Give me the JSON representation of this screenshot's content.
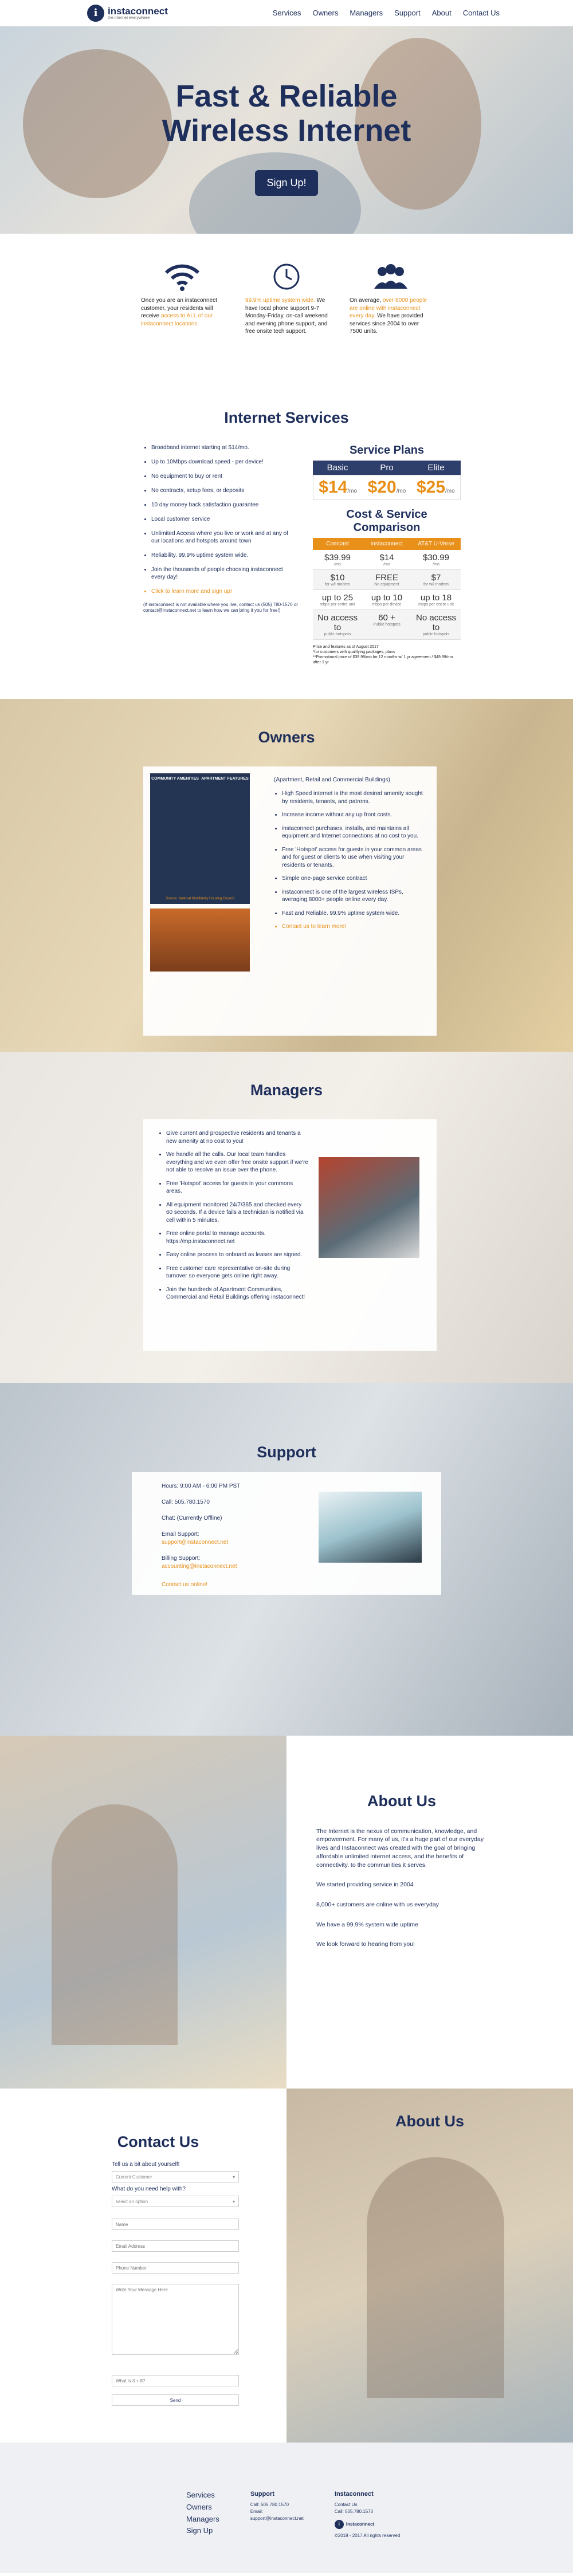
{
  "brand": {
    "name": "instaconnect",
    "tagline": "the internet everywhere",
    "logo_letter": "i"
  },
  "nav": [
    "Services",
    "Owners",
    "Managers",
    "Support",
    "About",
    "Contact Us"
  ],
  "hero": {
    "title_line1": "Fast & Reliable",
    "title_line2": "Wireless Internet",
    "cta": "Sign Up!"
  },
  "features": [
    {
      "icon": "wifi-icon",
      "pre": "Once you are an instaconnect customer, your residents will receive ",
      "hl": "access to ALL of our instaconnect locations.",
      "post": ""
    },
    {
      "icon": "clock-icon",
      "pre": "",
      "hl": "99.9% uptime system wide.",
      "post": " We have local phone support 9-7 Monday-Friday, on-call weekend and evening phone support, and free onsite tech support."
    },
    {
      "icon": "users-icon",
      "pre": "On average, ",
      "hl": "over 8000 people are online with instaconnect every day.",
      "post": " We have provided services since 2004 to over 7500 units."
    }
  ],
  "services": {
    "title": "Internet Services",
    "list": [
      "Broadband internet starting at $14/mo.",
      "Up to 10Mbps download speed - per device!",
      "No equipment to buy or rent",
      "No contracts, setup fees, or deposits",
      "10 day money back satisfaction guarantee",
      "Local customer service",
      "Unlimited Access where you live or work and at any of our locations and hotspots around town",
      "Reliability. 99.9% uptime system wide.",
      "Join the thousands of people choosing instaconnect every day!",
      "Click to learn more and sign up!"
    ],
    "note": "(If instaconnect is not available where you live, contact us (505) 780-1570 or contact@instaconnect.net to learn how we can bring it you for free!)",
    "plans_title": "Service Plans",
    "plans": [
      {
        "name": "Basic",
        "price": "$14",
        "per": "/mo"
      },
      {
        "name": "Pro",
        "price": "$20",
        "per": "/mo"
      },
      {
        "name": "Elite",
        "price": "$25",
        "per": "/mo"
      }
    ],
    "compare_title": "Cost & Service Comparison",
    "compare_head": [
      "Comcast",
      "instaconnect",
      "AT&T U-Verse"
    ],
    "compare_rows": [
      [
        {
          "v": "$39.99",
          "s": "/mo"
        },
        {
          "v": "$14",
          "s": "/mo"
        },
        {
          "v": "$30.99",
          "s": "/mo"
        }
      ],
      [
        {
          "v": "$10",
          "s": "for w/l modem"
        },
        {
          "v": "FREE",
          "s": "No equipment"
        },
        {
          "v": "$7",
          "s": "for w/l modem"
        }
      ],
      [
        {
          "v": "up to 25",
          "s": "mbps per entire unit"
        },
        {
          "v": "up to 10",
          "s": "mbps per device"
        },
        {
          "v": "up to 18",
          "s": "mbps per entire unit"
        }
      ],
      [
        {
          "v": "No access to",
          "s": "public hotspots"
        },
        {
          "v": "60 +",
          "s": "Public hotspots"
        },
        {
          "v": "No access to",
          "s": "public hotspots"
        }
      ]
    ],
    "fine_print": "Price and features as of August 2017\n*for customers with qualifying packages, plans\n**Promotional price of $39.99/mo for 12 months w/ 1 yr agreement / $49.99/mo after 1 yr"
  },
  "owners": {
    "title": "Owners",
    "subtitle": "(Apartment, Retail and Commercial Buildings)",
    "list": [
      "High Speed internet is the most desired amenity sought by residents, tenants, and patrons.",
      "Increase income without any up front costs.",
      "instaconnect purchases, installs, and maintains all equipment and Internet connections at no cost to you.",
      "Free 'Hotspot' access for guests in your common areas and for guest or clients to use when visiting your residents or tenants.",
      "Simple one-page service contract",
      "instaconnect is one of the largest wireless ISPs, averaging 8000+ people online every day.",
      "Fast and Reliable. 99.9% uptime system wide.",
      "Contact us to learn more!"
    ],
    "infographic_title_left": "COMMUNITY AMENITIES",
    "infographic_title_right": "APARTMENT FEATURES",
    "infographic_caption": "Source: National Multifamily Housing Council"
  },
  "managers": {
    "title": "Managers",
    "list": [
      "Give current and prospective residents and tenants a new amenity at no cost to you!",
      "We handle all the calls. Our local team handles everything and we even offer free onsite support if we're not able to resolve an issue over the phone.",
      "Free 'Hotspot' access for guests in your commons areas.",
      "All equipment monitored 24/7/365 and checked every 60 seconds. If a device fails a technician is notified via cell within 5 minutes.",
      "Free online portal to manage accounts. https://mp.instaconnect.net",
      "Easy online process to onboard as leases are signed.",
      "Free customer care representative on-site during turnover so everyone gets online right away.",
      "Join the hundreds of Apartment Communities, Commercial and Retail Buildings offering instaconnect!"
    ]
  },
  "support": {
    "title": "Support",
    "hours": "Hours: 9:00 AM - 6:00 PM PST",
    "call": "Call: 505.780.1570",
    "chat": "Chat: (Currently Offline)",
    "email_label": "Email Support:",
    "email": "support@instaconnect.net",
    "billing_label": "Billing Support:",
    "billing": "accounting@instaconnect.net",
    "cta": "Contact us online!"
  },
  "about": {
    "title": "About Us",
    "paras": [
      "The Internet is the nexus of communication, knowledge, and empowerment. For many of us, it's a huge part of our everyday lives and Instaconnect was created with the goal of bringing affordable unlimited internet access, and the benefits of connectivity, to the communities it serves.",
      "We started providing service in 2004",
      "8,000+ customers are online with us everyday",
      "We have a 99.9% system wide uptime",
      "We look forward to hearing from you!"
    ]
  },
  "contact": {
    "title": "Contact Us",
    "q1": "Tell us a bit about yourself!",
    "q1_value": "Current Customer",
    "q2": "What do you need help with?",
    "q2_value": "select an option",
    "ph_name": "Name",
    "ph_email": "Email Address",
    "ph_phone": "Phone Number",
    "ph_msg": "Write Your Message Here",
    "ph_captcha": "What is 3 + 8?",
    "send": "Send",
    "side_title": "About Us"
  },
  "footer": {
    "links": [
      "Services",
      "Owners",
      "Managers",
      "Sign Up"
    ],
    "support_title": "Support",
    "support_lines": [
      "Call: 505.780.1570",
      "Email:",
      "support@instaconnect.net"
    ],
    "company_title": "Instaconnect",
    "company_lines": [
      "Contact Us",
      "Call: 505.780.1570"
    ],
    "copyright": "©2018 - 2017 All rights reserved"
  },
  "colors": {
    "navy": "#1f2f5c",
    "orange": "#e8901a"
  }
}
